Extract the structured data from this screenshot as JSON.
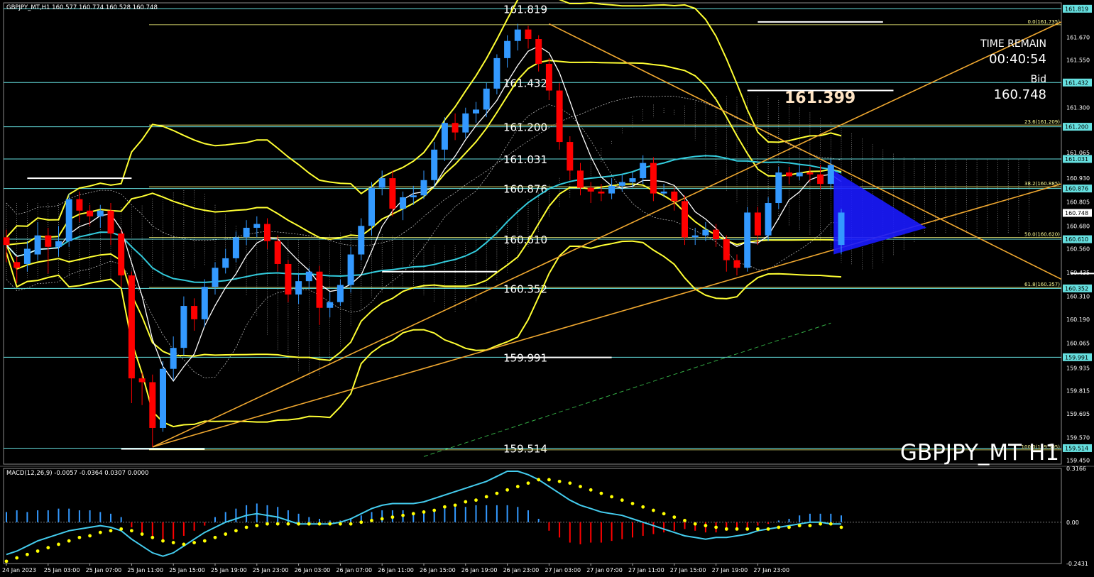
{
  "header": {
    "text": "GBPJPY_MT,H1  160.577 160.774 160.528 160.748"
  },
  "indicator_header": {
    "text": "MACD(12,26,9) -0.0057 -0.0364 0.0307 0.0000"
  },
  "symbol_label": "GBPJPY_MT H1",
  "time_remain": {
    "label": "TIME REMAIN",
    "value": "00:40:54"
  },
  "bid": {
    "label": "Bid",
    "value": "160.748"
  },
  "big_price": "161.399",
  "colors": {
    "background": "#000000",
    "bull": "#3399ff",
    "bear": "#ff0000",
    "level_line": "#66e0e0",
    "yellow": "#ffff33",
    "trend": "#f0a830",
    "macd_line": "#44ccee",
    "signal_dots": "#ffff00",
    "triangle": "#1a1aff"
  },
  "chart_data": [
    {
      "type": "candlestick",
      "title": "GBPJPY_MT,H1",
      "ylim": [
        159.43,
        161.85
      ],
      "y_ticks": [
        "161.819",
        "161.670",
        "161.550",
        "161.432",
        "161.300",
        "161.200",
        "161.065",
        "161.031",
        "160.930",
        "160.876",
        "160.805",
        "160.748",
        "160.680",
        "160.610",
        "160.560",
        "160.435",
        "160.352",
        "160.310",
        "160.190",
        "160.065",
        "159.991",
        "159.935",
        "159.815",
        "159.695",
        "159.570",
        "159.514",
        "159.450"
      ],
      "highlight_ticks": [
        "161.819",
        "161.432",
        "161.200",
        "161.031",
        "160.876",
        "160.748",
        "160.610",
        "160.352",
        "159.991",
        "159.514"
      ],
      "x_ticks": [
        "24 Jan 2023",
        "25 Jan 03:00",
        "25 Jan 07:00",
        "25 Jan 11:00",
        "25 Jan 15:00",
        "25 Jan 19:00",
        "25 Jan 23:00",
        "26 Jan 03:00",
        "26 Jan 07:00",
        "26 Jan 11:00",
        "26 Jan 15:00",
        "26 Jan 19:00",
        "26 Jan 23:00",
        "27 Jan 03:00",
        "27 Jan 07:00",
        "27 Jan 11:00",
        "27 Jan 15:00",
        "27 Jan 19:00",
        "27 Jan 23:00"
      ],
      "levels": [
        {
          "price": 161.819,
          "label": "161.819"
        },
        {
          "price": 161.432,
          "label": "161.432"
        },
        {
          "price": 161.2,
          "label": "161.200"
        },
        {
          "price": 161.031,
          "label": "161.031"
        },
        {
          "price": 160.876,
          "label": "160.876"
        },
        {
          "price": 160.61,
          "label": "160.610"
        },
        {
          "price": 160.352,
          "label": "160.352"
        },
        {
          "price": 159.991,
          "label": "159.991"
        },
        {
          "price": 159.514,
          "label": "159.514"
        }
      ],
      "fib_levels": [
        {
          "price": 161.735,
          "label": "0.0(161.735)"
        },
        {
          "price": 161.209,
          "label": "23.6(161.209)"
        },
        {
          "price": 160.885,
          "label": "38.2(160.885)"
        },
        {
          "price": 160.62,
          "label": "50.0(160.620)"
        },
        {
          "price": 160.357,
          "label": "61.8(160.357)"
        },
        {
          "price": 159.505,
          "label": "100.0(159.505)"
        }
      ],
      "candles": [
        [
          160.62,
          160.58,
          160.66,
          160.49
        ],
        [
          160.49,
          160.46,
          160.52,
          160.38
        ],
        [
          160.48,
          160.56,
          160.6,
          160.44
        ],
        [
          160.53,
          160.63,
          160.7,
          160.5
        ],
        [
          160.63,
          160.57,
          160.67,
          160.43
        ],
        [
          160.57,
          160.6,
          160.68,
          160.52
        ],
        [
          160.6,
          160.82,
          160.85,
          160.57
        ],
        [
          160.82,
          160.76,
          160.86,
          160.7
        ],
        [
          160.76,
          160.73,
          160.79,
          160.68
        ],
        [
          160.73,
          160.76,
          160.79,
          160.67
        ],
        [
          160.76,
          160.64,
          160.8,
          160.58
        ],
        [
          160.64,
          160.42,
          160.66,
          160.36
        ],
        [
          160.42,
          159.88,
          160.44,
          159.75
        ],
        [
          159.88,
          159.86,
          159.91,
          159.74
        ],
        [
          159.86,
          159.62,
          159.9,
          159.52
        ],
        [
          159.62,
          159.93,
          159.97,
          159.6
        ],
        [
          159.93,
          160.04,
          160.1,
          159.87
        ],
        [
          160.04,
          160.26,
          160.31,
          160.0
        ],
        [
          160.26,
          160.19,
          160.3,
          160.13
        ],
        [
          160.19,
          160.36,
          160.4,
          160.15
        ],
        [
          160.36,
          160.46,
          160.49,
          160.32
        ],
        [
          160.46,
          160.51,
          160.56,
          160.43
        ],
        [
          160.51,
          160.62,
          160.65,
          160.49
        ],
        [
          160.62,
          160.67,
          160.71,
          160.58
        ],
        [
          160.67,
          160.69,
          160.73,
          160.62
        ],
        [
          160.69,
          160.6,
          160.72,
          160.56
        ],
        [
          160.6,
          160.48,
          160.63,
          160.44
        ],
        [
          160.48,
          160.32,
          160.5,
          160.28
        ],
        [
          160.32,
          160.39,
          160.43,
          160.27
        ],
        [
          160.39,
          160.44,
          160.46,
          160.35
        ],
        [
          160.44,
          160.25,
          160.47,
          160.16
        ],
        [
          160.25,
          160.28,
          160.33,
          160.2
        ],
        [
          160.28,
          160.37,
          160.4,
          160.26
        ],
        [
          160.37,
          160.53,
          160.57,
          160.33
        ],
        [
          160.53,
          160.68,
          160.72,
          160.5
        ],
        [
          160.68,
          160.88,
          160.91,
          160.63
        ],
        [
          160.88,
          160.93,
          160.97,
          160.84
        ],
        [
          160.93,
          160.77,
          160.97,
          160.73
        ],
        [
          160.77,
          160.83,
          160.86,
          160.71
        ],
        [
          160.83,
          160.84,
          160.89,
          160.79
        ],
        [
          160.84,
          160.92,
          160.97,
          160.82
        ],
        [
          160.92,
          161.08,
          161.12,
          160.88
        ],
        [
          161.08,
          161.22,
          161.25,
          161.02
        ],
        [
          161.22,
          161.17,
          161.27,
          161.13
        ],
        [
          161.17,
          161.27,
          161.3,
          161.14
        ],
        [
          161.27,
          161.29,
          161.33,
          161.22
        ],
        [
          161.29,
          161.4,
          161.43,
          161.25
        ],
        [
          161.4,
          161.56,
          161.58,
          161.37
        ],
        [
          161.56,
          161.65,
          161.68,
          161.51
        ],
        [
          161.65,
          161.71,
          161.74,
          161.6
        ],
        [
          161.71,
          161.66,
          161.73,
          161.61
        ],
        [
          161.66,
          161.53,
          161.68,
          161.49
        ],
        [
          161.53,
          161.39,
          161.56,
          161.34
        ],
        [
          161.39,
          161.12,
          161.43,
          161.08
        ],
        [
          161.12,
          160.97,
          161.15,
          160.92
        ],
        [
          160.97,
          160.88,
          161.01,
          160.84
        ],
        [
          160.88,
          160.86,
          160.91,
          160.8
        ],
        [
          160.86,
          160.85,
          160.9,
          160.81
        ],
        [
          160.85,
          160.89,
          160.93,
          160.82
        ],
        [
          160.89,
          160.91,
          160.95,
          160.86
        ],
        [
          160.91,
          160.93,
          160.96,
          160.88
        ],
        [
          160.93,
          161.01,
          161.05,
          160.9
        ],
        [
          161.01,
          160.85,
          161.04,
          160.81
        ],
        [
          160.85,
          160.86,
          160.9,
          160.83
        ],
        [
          160.86,
          160.81,
          160.88,
          160.76
        ],
        [
          160.81,
          160.62,
          160.84,
          160.58
        ],
        [
          160.62,
          160.63,
          160.67,
          160.58
        ],
        [
          160.63,
          160.66,
          160.7,
          160.6
        ],
        [
          160.66,
          160.61,
          160.69,
          160.57
        ],
        [
          160.61,
          160.5,
          160.63,
          160.44
        ],
        [
          160.5,
          160.46,
          160.53,
          160.42
        ],
        [
          160.46,
          160.75,
          160.78,
          160.44
        ],
        [
          160.75,
          160.63,
          160.78,
          160.58
        ],
        [
          160.63,
          160.8,
          160.83,
          160.6
        ],
        [
          160.8,
          160.96,
          160.99,
          160.77
        ],
        [
          160.96,
          160.94,
          160.99,
          160.9
        ],
        [
          160.94,
          160.96,
          161.0,
          160.92
        ],
        [
          160.96,
          160.95,
          160.99,
          160.91
        ],
        [
          160.95,
          160.9,
          161.0,
          160.87
        ],
        [
          160.9,
          161.0,
          161.03,
          160.87
        ],
        [
          160.58,
          160.75,
          160.77,
          160.53
        ]
      ],
      "pending_levels": [
        {
          "from_bar": 2,
          "to_bar": 12,
          "price": 160.93
        },
        {
          "from_bar": 36,
          "to_bar": 47,
          "price": 160.44
        },
        {
          "from_bar": 48,
          "to_bar": 58,
          "price": 159.99
        },
        {
          "from_bar": 11,
          "to_bar": 19,
          "price": 159.51
        },
        {
          "from_bar": 72,
          "to_bar": 84,
          "price": 161.75
        },
        {
          "from_bar": 71,
          "to_bar": 85,
          "price": 161.39
        },
        {
          "from_bar": 102,
          "to_bar": 115,
          "price": 160.43
        }
      ]
    },
    {
      "type": "macd",
      "title": "MACD(12,26,9)",
      "ylim": [
        -0.2431,
        0.3166
      ],
      "y_ticks": [
        "0.3166",
        "0.00",
        "-0.2431"
      ],
      "histogram": [
        0.06,
        0.07,
        0.06,
        0.07,
        0.07,
        0.08,
        0.08,
        0.07,
        0.07,
        0.06,
        0.05,
        0.03,
        -0.03,
        -0.06,
        -0.1,
        -0.12,
        -0.1,
        -0.08,
        -0.05,
        -0.02,
        0.03,
        0.06,
        0.08,
        0.1,
        0.11,
        0.1,
        0.09,
        0.07,
        0.05,
        0.03,
        0.02,
        0.01,
        0.01,
        0.02,
        0.04,
        0.06,
        0.07,
        0.07,
        0.07,
        0.06,
        0.06,
        0.07,
        0.08,
        0.09,
        0.09,
        0.1,
        0.1,
        0.1,
        0.1,
        0.09,
        0.07,
        0.02,
        -0.05,
        -0.09,
        -0.12,
        -0.13,
        -0.12,
        -0.12,
        -0.11,
        -0.1,
        -0.09,
        -0.08,
        -0.07,
        -0.06,
        -0.05,
        -0.04,
        -0.05,
        -0.06,
        -0.06,
        -0.05,
        -0.04,
        -0.03,
        -0.02,
        -0.01,
        0.01,
        0.02,
        0.04,
        0.05,
        0.05,
        0.05,
        0.04
      ],
      "macd": [
        -0.19,
        -0.17,
        -0.14,
        -0.11,
        -0.09,
        -0.07,
        -0.05,
        -0.04,
        -0.03,
        -0.02,
        -0.03,
        -0.05,
        -0.1,
        -0.14,
        -0.18,
        -0.2,
        -0.18,
        -0.14,
        -0.1,
        -0.06,
        -0.03,
        0.0,
        0.02,
        0.04,
        0.05,
        0.04,
        0.03,
        0.01,
        -0.01,
        -0.01,
        -0.01,
        -0.01,
        0.0,
        0.02,
        0.05,
        0.08,
        0.1,
        0.11,
        0.11,
        0.11,
        0.12,
        0.14,
        0.16,
        0.18,
        0.2,
        0.22,
        0.24,
        0.27,
        0.3,
        0.3,
        0.28,
        0.25,
        0.21,
        0.17,
        0.13,
        0.1,
        0.08,
        0.06,
        0.05,
        0.04,
        0.02,
        0.0,
        -0.02,
        -0.04,
        -0.06,
        -0.08,
        -0.09,
        -0.1,
        -0.09,
        -0.09,
        -0.08,
        -0.07,
        -0.05,
        -0.04,
        -0.03,
        -0.02,
        -0.01,
        0.0,
        0.0,
        -0.01,
        -0.01
      ],
      "signal": [
        -0.23,
        -0.21,
        -0.19,
        -0.17,
        -0.15,
        -0.13,
        -0.11,
        -0.09,
        -0.08,
        -0.06,
        -0.05,
        -0.04,
        -0.05,
        -0.07,
        -0.09,
        -0.11,
        -0.12,
        -0.13,
        -0.12,
        -0.11,
        -0.09,
        -0.07,
        -0.05,
        -0.03,
        -0.02,
        -0.01,
        -0.01,
        -0.01,
        -0.01,
        -0.01,
        -0.01,
        -0.01,
        -0.01,
        -0.01,
        0.0,
        0.01,
        0.02,
        0.03,
        0.04,
        0.05,
        0.06,
        0.07,
        0.09,
        0.1,
        0.12,
        0.13,
        0.15,
        0.17,
        0.19,
        0.21,
        0.23,
        0.25,
        0.25,
        0.24,
        0.23,
        0.21,
        0.19,
        0.17,
        0.15,
        0.13,
        0.11,
        0.09,
        0.07,
        0.05,
        0.03,
        0.01,
        -0.01,
        -0.02,
        -0.03,
        -0.04,
        -0.04,
        -0.04,
        -0.04,
        -0.04,
        -0.03,
        -0.03,
        -0.02,
        -0.02,
        -0.01,
        -0.01,
        -0.03
      ]
    }
  ]
}
